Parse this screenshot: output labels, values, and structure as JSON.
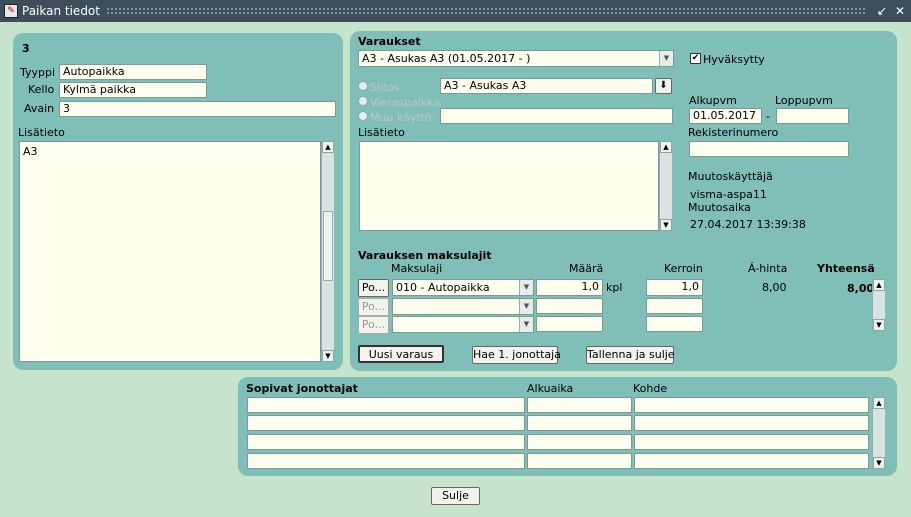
{
  "window": {
    "title": "Paikan tiedot"
  },
  "place": {
    "id": "3",
    "type_label": "Tyyppi",
    "type_value": "Autopaikka",
    "clock_label": "Kello",
    "clock_value": "Kylmä paikka",
    "key_label": "Avain",
    "key_value": "3",
    "extra_label": "Lisätieto",
    "extra_value": "A3"
  },
  "reservations": {
    "title": "Varaukset",
    "selected": "A3 - Asukas A3 (01.05.2017 - )",
    "approved_label": "Hyväksytty",
    "binding_label": "Sidos",
    "binding_value": "A3 - Asukas A3",
    "guest_label": "Vieraspaikka",
    "other_label": "Muu käyttö:",
    "extra_label": "Lisätieto",
    "start_label": "Alkupvm",
    "start_value": "01.05.2017",
    "end_label": "Loppupvm",
    "dash": "-",
    "reg_label": "Rekisterinumero",
    "modifier_label": "Muutoskäyttäjä",
    "modifier_value": "visma-aspa11",
    "modtime_label": "Muutosaika",
    "modtime_value": "27.04.2017 13:39:38"
  },
  "fees": {
    "title": "Varauksen maksulajit",
    "col_type": "Maksulaji",
    "col_qty": "Määrä",
    "col_factor": "Kerroin",
    "col_price": "Á-hinta",
    "col_total": "Yhteensä",
    "row_button": "Po...",
    "rows": [
      {
        "type": "010 - Autopaikka",
        "qty": "1,0",
        "unit": "kpl",
        "factor": "1,0",
        "price": "8,00",
        "total": "8,00"
      }
    ]
  },
  "buttons": {
    "new_reservation": "Uusi varaus",
    "fetch_first": "Hae 1. jonottaja",
    "save_close": "Tallenna ja sulje",
    "close": "Sulje"
  },
  "queue": {
    "title": "Sopivat jonottajat",
    "col_start": "Alkuaika",
    "col_target": "Kohde"
  },
  "colors": {
    "background": "#c6e3cb",
    "panel": "#7fbfb7",
    "field": "#fffff0",
    "titlebar": "#3d4d5a"
  }
}
